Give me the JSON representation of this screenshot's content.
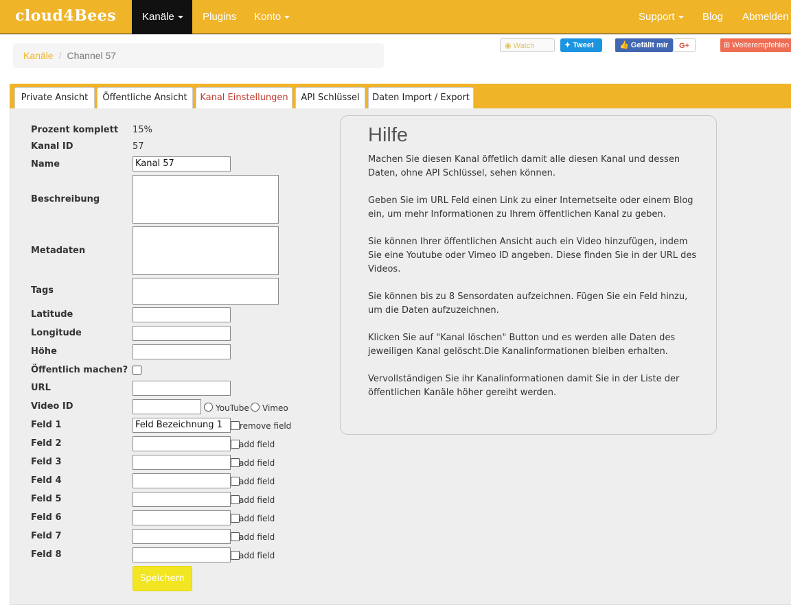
{
  "navbar": {
    "brand": "cloud4Bees",
    "channels": "Kanäle",
    "plugins": "Plugins",
    "account": "Konto",
    "support": "Support",
    "blog": "Blog",
    "logout": "Abmelden"
  },
  "breadcrumb": {
    "root": "Kanäle",
    "separator": "/",
    "current": "Channel 57"
  },
  "social": {
    "watch": "Watch",
    "tweet": "Tweet",
    "like": "Gefällt mir",
    "gplus": "G+",
    "recommend": "Weiterempfehlen"
  },
  "tabs": [
    {
      "label": "Private Ansicht"
    },
    {
      "label": "Öffentliche Ansicht"
    },
    {
      "label": "Kanal Einstellungen"
    },
    {
      "label": "API Schlüssel"
    },
    {
      "label": "Daten Import / Export"
    }
  ],
  "form": {
    "percent_label": "Prozent komplett",
    "percent_value": "15%",
    "channel_id_label": "Kanal ID",
    "channel_id_value": "57",
    "name_label": "Name",
    "name_value": "Kanal 57",
    "description_label": "Beschreibung",
    "metadata_label": "Metadaten",
    "tags_label": "Tags",
    "latitude_label": "Latitude",
    "longitude_label": "Longitude",
    "elevation_label": "Höhe",
    "public_label": "Öffentlich machen?",
    "url_label": "URL",
    "video_label": "Video ID",
    "youtube_label": "YouTube",
    "vimeo_label": "Vimeo",
    "fields": [
      {
        "label": "Feld 1",
        "value": "Feld Bezeichnung 1",
        "action": "remove field"
      },
      {
        "label": "Feld 2",
        "value": "",
        "action": "add field"
      },
      {
        "label": "Feld 3",
        "value": "",
        "action": "add field"
      },
      {
        "label": "Feld 4",
        "value": "",
        "action": "add field"
      },
      {
        "label": "Feld 5",
        "value": "",
        "action": "add field"
      },
      {
        "label": "Feld 6",
        "value": "",
        "action": "add field"
      },
      {
        "label": "Feld 7",
        "value": "",
        "action": "add field"
      },
      {
        "label": "Feld 8",
        "value": "",
        "action": "add field"
      }
    ],
    "save": "Speichern"
  },
  "help": {
    "title": "Hilfe",
    "paragraphs": [
      "Machen Sie diesen Kanal öffetlich damit alle diesen Kanal und dessen Daten, ohne API Schlüssel, sehen können.",
      "Geben Sie im URL Feld einen Link zu einer Internetseite oder einem Blog ein, um mehr Informationen zu Ihrem öffentlichen Kanal zu geben.",
      "Sie können Ihrer öffentlichen Ansicht auch ein Video hinzufügen, indem Sie eine Youtube oder Vimeo ID angeben. Diese finden Sie in der URL des Videos.",
      "Sie können bis zu 8 Sensordaten aufzeichnen. Fügen Sie ein Feld hinzu, um die Daten aufzuzeichnen.",
      "Klicken Sie auf \"Kanal löschen\" Button und es werden alle Daten des jeweiligen Kanal gelöscht.Die Kanalinformationen bleiben erhalten.",
      "Vervollständigen Sie ihr Kanalinformationen damit Sie in der Liste der öffentlichen Kanäle höher gereiht werden."
    ]
  },
  "colors": {
    "brand": "#f0b429",
    "active_nav": "#111111",
    "active_tab_text": "#c0392b",
    "save_button": "#f2e522"
  }
}
